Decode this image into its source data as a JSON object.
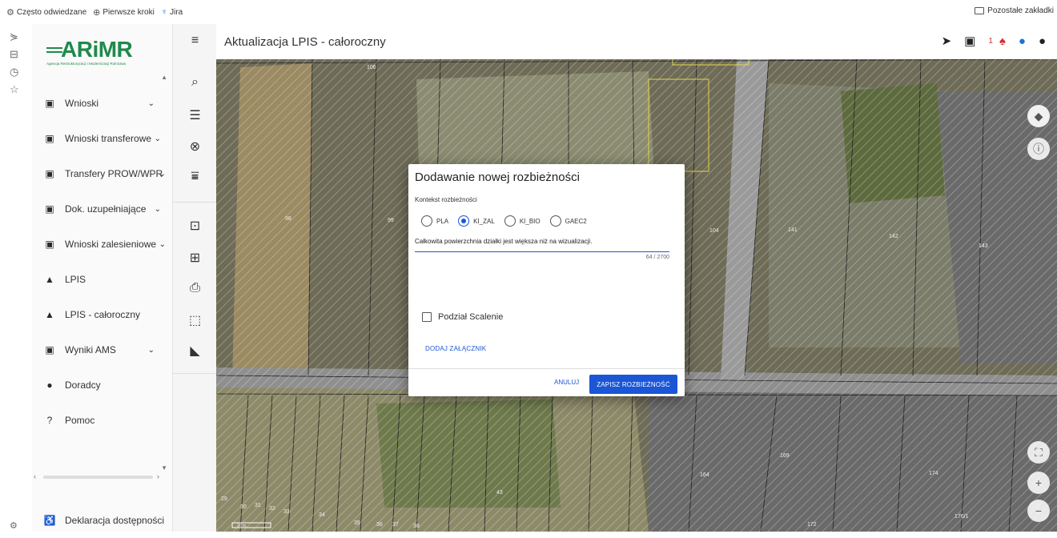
{
  "bookmarks": {
    "items": [
      {
        "label": "Często odwiedzane",
        "icon": "gear-icon"
      },
      {
        "label": "Pierwsze kroki",
        "icon": "globe-icon"
      },
      {
        "label": "Jira",
        "icon": "jira-icon"
      }
    ],
    "other": "Pozostałe zakładki"
  },
  "logo": {
    "text": "ARiMR",
    "subtitle": "Agencja Restrukturyzacji i Modernizacji Rolnictwa"
  },
  "sidebar": {
    "items": [
      {
        "label": "Wnioski",
        "icon": "clipboard-icon",
        "expandable": true
      },
      {
        "label": "Wnioski transferowe",
        "icon": "clipboard-icon",
        "expandable": true
      },
      {
        "label": "Transfery PROW/WPR",
        "icon": "clipboard-icon",
        "expandable": true
      },
      {
        "label": "Dok. uzupełniające",
        "icon": "clipboard-icon",
        "expandable": true
      },
      {
        "label": "Wnioski zalesieniowe",
        "icon": "clipboard-icon",
        "expandable": true
      },
      {
        "label": "LPIS",
        "icon": "mountain-icon",
        "expandable": false
      },
      {
        "label": "LPIS - całoroczny",
        "icon": "mountain-icon",
        "expandable": false
      },
      {
        "label": "Wyniki AMS",
        "icon": "clipboard-icon",
        "expandable": true
      },
      {
        "label": "Doradcy",
        "icon": "person-icon",
        "expandable": false
      },
      {
        "label": "Pomoc",
        "icon": "help-icon",
        "expandable": false
      }
    ],
    "footer": "Deklaracja dostępności"
  },
  "header": {
    "title": "Aktualizacja LPIS - całoroczny",
    "notification_count": "1"
  },
  "map": {
    "parcel_labels": [
      "106",
      "98",
      "99",
      "104",
      "141",
      "142",
      "143",
      "169",
      "164",
      "174",
      "172",
      "176/1",
      "29",
      "30",
      "31",
      "32",
      "33",
      "34",
      "35",
      "36",
      "37",
      "38",
      "43"
    ],
    "scale": "20 m"
  },
  "dialog": {
    "title": "Dodawanie nowej rozbieżności",
    "context_label": "Kontekst rozbieżności",
    "options": [
      "PLA",
      "KI_ZAL",
      "KI_BIO",
      "GAEC2"
    ],
    "selected": "KI_ZAL",
    "text_value": "Całkowita powierzchnia działki jest większa niż na wizualizacji.",
    "char_count": "64 / 2700",
    "checkbox_label": "Podział Scalenie",
    "attach_label": "DODAJ ZAŁĄCZNIK",
    "cancel_label": "ANULUJ",
    "save_label": "ZAPISZ ROZBIEŻNOŚĆ"
  },
  "colors": {
    "brand": "#1f8a4c",
    "primary": "#1a56d6",
    "alert": "#d32f2f"
  }
}
